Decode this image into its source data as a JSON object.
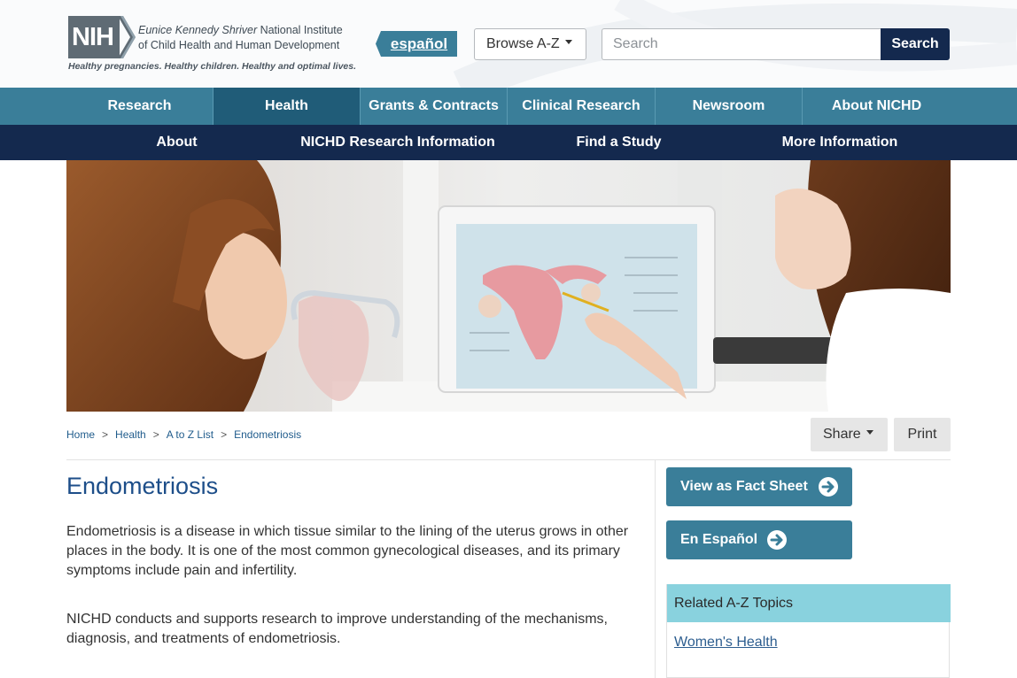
{
  "header": {
    "logo_mark": "NIH",
    "institute_line1_italic": "Eunice Kennedy Shriver",
    "institute_line1_rest": " National Institute",
    "institute_line2": "of Child Health and Human Development",
    "tagline": "Healthy pregnancies. Healthy children. Healthy and optimal lives.",
    "espanol_label": "español",
    "browse_label": "Browse A-Z",
    "search_placeholder": "Search",
    "search_button": "Search"
  },
  "nav_primary": [
    {
      "label": "Research",
      "active": false
    },
    {
      "label": "Health",
      "active": true
    },
    {
      "label": "Grants & Contracts",
      "active": false
    },
    {
      "label": "Clinical Research",
      "active": false
    },
    {
      "label": "Newsroom",
      "active": false
    },
    {
      "label": "About NICHD",
      "active": false
    }
  ],
  "nav_secondary": [
    {
      "label": "About"
    },
    {
      "label": "NICHD Research Information"
    },
    {
      "label": "Find a Study"
    },
    {
      "label": "More Information"
    }
  ],
  "breadcrumb": [
    "Home",
    "Health",
    "A to Z List",
    "Endometriosis"
  ],
  "tools": {
    "share": "Share",
    "print": "Print"
  },
  "main": {
    "title": "Endometriosis",
    "paragraphs": [
      "Endometriosis is a disease in which tissue similar to the lining of the uterus grows in other places in the body. It is one of the most common gynecological diseases, and its primary symptoms include pain and infertility.",
      "NICHD conducts and supports research to improve understanding of the mechanisms, diagnosis, and treatments of endometriosis."
    ]
  },
  "sidebar": {
    "fact_sheet_button": "View as Fact Sheet",
    "espanol_button": "En Español",
    "related_heading": "Related A-Z Topics",
    "related_links": [
      "Women's Health"
    ]
  },
  "colors": {
    "nav_primary": "#3a7e99",
    "nav_primary_active": "#205c78",
    "nav_secondary": "#14294e",
    "title": "#1d4e89",
    "related_header": "#89d2de"
  }
}
